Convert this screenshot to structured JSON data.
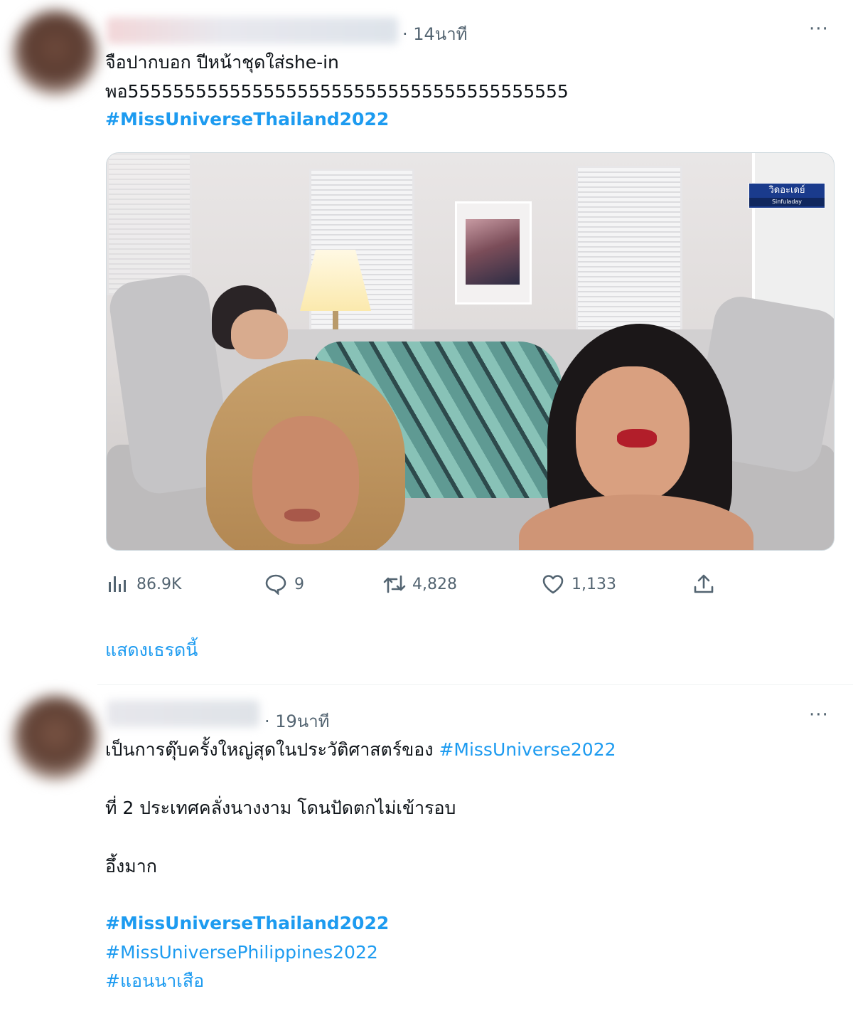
{
  "colors": {
    "accent": "#1d9bf0",
    "text": "#0f1419",
    "secondary": "#536471",
    "divider": "#eff3f4"
  },
  "tweets": [
    {
      "time": "· 14นาที",
      "more_label": "···",
      "lines": [
        "จือปากบอก ปีหน้าชุดใส่she-in",
        "พอ555555555555555555555555555555555555555"
      ],
      "hashtags": [
        "#MissUniverseThailand2022"
      ],
      "media": {
        "type": "video-frame",
        "watermark": "วิดอะเดย์",
        "watermark_sub": "Sinfuladay"
      },
      "actions": {
        "views": "86.9K",
        "replies": "9",
        "retweets": "4,828",
        "likes": "1,133"
      },
      "icons": {
        "views": "analytics-icon",
        "reply": "reply-bubble-icon",
        "retweet": "retweet-icon",
        "like": "heart-icon",
        "share": "share-upload-icon"
      },
      "show_thread": "แสดงเธรดนี้"
    },
    {
      "time": "· 19นาที",
      "more_label": "···",
      "line1_text": "เป็นการตุ๊บครั้งใหญ่สุดในประวัติศาสตร์ของ ",
      "line1_hashtag": "#MissUniverse2022",
      "line2": "ที่ 2 ประเทศคลั่งนางงาม โดนปัดตกไม่เข้ารอบ",
      "line3": "อึ้งมาก",
      "hashtags": [
        "#MissUniverseThailand2022",
        "#MissUniversePhilippines2022",
        "#แอนนาเสือ"
      ]
    }
  ]
}
